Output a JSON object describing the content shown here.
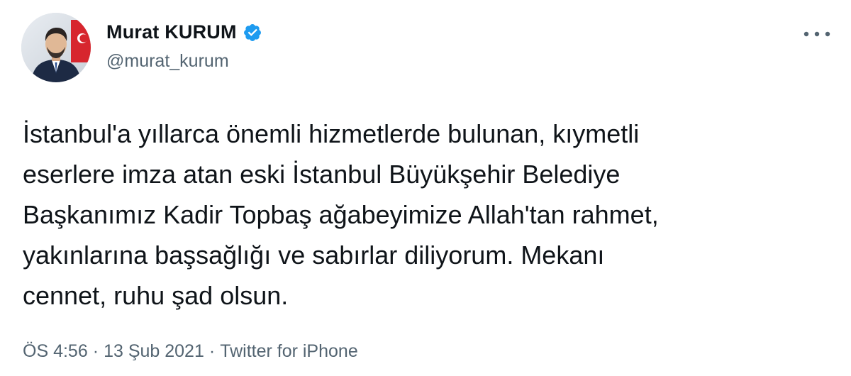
{
  "author": {
    "display_name": "Murat KURUM",
    "handle": "@murat_kurum",
    "verified": true,
    "avatar_icon": "profile-photo"
  },
  "tweet": {
    "text_lines": [
      "İstanbul'a yıllarca önemli hizmetlerde bulunan, kıymetli",
      "eserlere imza atan eski İstanbul Büyükşehir Belediye",
      "Başkanımız Kadir Topbaş ağabeyimize Allah'tan rahmet,",
      "yakınlarına başsağlığı ve sabırlar diliyorum. Mekanı",
      "cennet, ruhu şad olsun."
    ]
  },
  "meta": {
    "time": "ÖS 4:56",
    "separator": "·",
    "date": "13 Şub 2021",
    "source": "Twitter for iPhone"
  },
  "icons": {
    "verified": "verified-badge-icon",
    "more": "more-options-icon"
  },
  "colors": {
    "text": "#0f1419",
    "secondary": "#536471",
    "verified_blue": "#1d9bf0"
  }
}
